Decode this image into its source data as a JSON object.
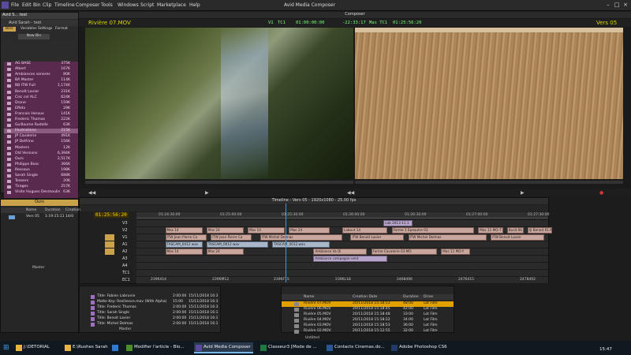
{
  "menu": {
    "items": [
      "File",
      "Edit",
      "Bin",
      "Clip",
      "Timeline",
      "Composer",
      "Tools",
      "Windows",
      "Script",
      "Marketplace",
      "Help"
    ],
    "title": "Avid Media Composer"
  },
  "bin": {
    "title": "Avid S... test",
    "subtitle": "Avid Sarah - test",
    "tabs": [
      "Bins",
      "Variables",
      "Settings",
      "Format"
    ],
    "button": "New Bin",
    "items": [
      {
        "name": "AG BASE",
        "size": "375K"
      },
      {
        "name": "Albert",
        "size": "167K"
      },
      {
        "name": "Ambiances sonores",
        "size": "80K"
      },
      {
        "name": "BA Master",
        "size": "114K"
      },
      {
        "name": "BB ITW Full",
        "size": "1,174K"
      },
      {
        "name": "Benoît Lavier",
        "size": "231K"
      },
      {
        "name": "Cisc col ALC",
        "size": "624K"
      },
      {
        "name": "Drone",
        "size": "159K"
      },
      {
        "name": "Effets",
        "size": "29K"
      },
      {
        "name": "Francois Heroux",
        "size": "141K"
      },
      {
        "name": "Frederic Thomas",
        "size": "222K"
      },
      {
        "name": "Guillaume Rudelle",
        "size": "63K"
      },
      {
        "name": "Illustrations",
        "size": "215K"
      },
      {
        "name": "JP Cavalerie",
        "size": "491K"
      },
      {
        "name": "JP Delfrino",
        "size": "156K"
      },
      {
        "name": "Masters",
        "size": "12K"
      },
      {
        "name": "Old Versions",
        "size": "6,394K"
      },
      {
        "name": "Ours",
        "size": "2,517K"
      },
      {
        "name": "Philippe Bosc",
        "size": "366K"
      },
      {
        "name": "Ressous",
        "size": "198K"
      },
      {
        "name": "Sarah Single",
        "size": "688K"
      },
      {
        "name": "Teasers",
        "size": "20K"
      },
      {
        "name": "Tirages",
        "size": "257K"
      },
      {
        "name": "Visite Hugues Desmoulin",
        "size": "63K"
      }
    ]
  },
  "composer": {
    "title": "Composer",
    "source_name": "Rivière 07.MOV",
    "v1": "V1",
    "tc1_label": "TC1",
    "tc1": "01:00:00:00",
    "duration": "-22:33:17",
    "mas_label": "Mas TC1",
    "mas_tc": "01:25:56:20",
    "record_name": "Vers 05"
  },
  "timeline": {
    "title": "Timeline - Vers 05 - 1920x1080 - 25.00 fps",
    "timecode": "01:25:56:20",
    "ticks": [
      "01:24:30:00",
      "01:25:00:00",
      "01:25:30:00",
      "01:26:00:00",
      "01:26:30:00",
      "01:27:00:00",
      "01:27:30:00"
    ],
    "tracks": [
      "V3",
      "V2",
      "V1",
      "A1",
      "A2",
      "A3",
      "A4",
      "TC1",
      "EC1"
    ],
    "clips": [
      {
        "text": "Lab 2013-11.1",
        "lane": 0
      },
      {
        "text": "Mas 14",
        "lane": 1
      },
      {
        "text": "Mas 24",
        "lane": 1
      },
      {
        "text": "Mas 14",
        "lane": 1
      },
      {
        "text": "Mas 24",
        "lane": 1
      },
      {
        "text": "Labout 14",
        "lane": 1
      },
      {
        "text": "Ferme 1 Epeautre 02",
        "lane": 1
      },
      {
        "text": "Mas 11 MO-7",
        "lane": 1
      },
      {
        "text": "Busit 06",
        "lane": 1
      },
      {
        "text": "Ijl Benoit 01.MOV",
        "lane": 1
      },
      {
        "text": "ITW Jean Pierre Ca",
        "lane": 2
      },
      {
        "text": "ITW Jean Pierre Ca",
        "lane": 2
      },
      {
        "text": "ITW Michel Delmas",
        "lane": 2
      },
      {
        "text": "ITW Benoit Lavier",
        "lane": 2
      },
      {
        "text": "ITW Michel Delmas",
        "lane": 2
      },
      {
        "text": "ITW Benoit Lavier",
        "lane": 2
      },
      {
        "text": "TASCAM_0012 wav",
        "lane": 3
      },
      {
        "text": "TASCAM_0012 wav",
        "lane": 3
      },
      {
        "text": "TASCAM_0012.wav",
        "lane": 3
      },
      {
        "text": "Mas 14",
        "lane": 4
      },
      {
        "text": "Mas 24",
        "lane": 4
      },
      {
        "text": "Ambiance Va Di",
        "lane": 4
      },
      {
        "text": "Ferme Cavalerie 03.MO",
        "lane": 4
      },
      {
        "text": "Mas 11 MO-Y",
        "lane": 4
      },
      {
        "text": "Ambiance campagne vent",
        "lane": 5
      }
    ],
    "tc_row": [
      "2396414",
      "2396M12",
      "2396F15",
      "2396L18",
      "2468406",
      "2476415",
      "2478402"
    ]
  },
  "bin_ours": {
    "title": "Ours",
    "headers": [
      "Name",
      "Duration",
      "Creation"
    ],
    "rows": [
      {
        "name": "Vers 05",
        "dur": "1:19:15:11",
        "creation": "14/0"
      }
    ],
    "footer": "Master"
  },
  "bin_titles": {
    "rows": [
      {
        "name": "Title: Fabien Labrunie",
        "dur": "2:00:00",
        "date": "15/11/2018 16:3"
      },
      {
        "name": "Matte Key: Resilience.mov (With Alpha)",
        "dur": "15:00",
        "date": "15/11/2018 16:3"
      },
      {
        "name": "Title: Frederic Thomas",
        "dur": "2:00:00",
        "date": "15/11/2018 16:3"
      },
      {
        "name": "Title: Sarah Single",
        "dur": "2:00:00",
        "date": "15/11/2018 16:1"
      },
      {
        "name": "Title: Benoit Lavier",
        "dur": "2:00:00",
        "date": "15/11/2018 16:1"
      },
      {
        "name": "Title: Michel Delmas",
        "dur": "2:00:00",
        "date": "15/11/2018 16:1"
      }
    ],
    "footer": "Master"
  },
  "bin_rivieres": {
    "headers": [
      "Name",
      "Creation Date",
      "Duration",
      "Drive"
    ],
    "rows": [
      {
        "name": "Rivière 07.MOV",
        "date": "20/11/2018 15:18:53",
        "dur": "48:00",
        "drive": "Lot Film"
      },
      {
        "name": "Rivière 06.MOV",
        "date": "20/11/2018 15:18:45",
        "dur": "42:00",
        "drive": "Lot Film"
      },
      {
        "name": "Rivière 05.MOV",
        "date": "20/11/2018 15:18:48",
        "dur": "33:00",
        "drive": "Lot Film"
      },
      {
        "name": "Rivière 04.MOV",
        "date": "20/11/2018 15:18:22",
        "dur": "34:00",
        "drive": "Lot Film"
      },
      {
        "name": "Rivière 03.MOV",
        "date": "20/11/2018 15:18:53",
        "dur": "36:00",
        "drive": "Lot Film"
      },
      {
        "name": "Rivière 02.MOV",
        "date": "20/11/2018 15:12:55",
        "dur": "32:00",
        "drive": "Lot Film"
      }
    ],
    "footer": "Untitled"
  },
  "taskbar": {
    "items": [
      {
        "label": "J:\\DETORIAL",
        "color": "#e8b341"
      },
      {
        "label": "E:\\Rushes Sarah",
        "color": "#e8b341"
      },
      {
        "label": "",
        "color": "#2f79d6"
      },
      {
        "label": "Modifier l'article - Blo...",
        "color": "#4c8f2a"
      },
      {
        "label": "Avid Media Composer",
        "color": "#5a4ba0"
      },
      {
        "label": "Classeur3 [Mode de ...",
        "color": "#1f7a3f"
      },
      {
        "label": "Contacts Cinemas.do...",
        "color": "#2b5797"
      },
      {
        "label": "Adobe Photoshop CS6",
        "color": "#1f3b66"
      }
    ],
    "clock": "15:47"
  },
  "colors": {
    "bin_bg": "#5a2a4e",
    "selection": "#e0a000",
    "timecode": "#ffd400",
    "source_name": "#d9d900"
  }
}
